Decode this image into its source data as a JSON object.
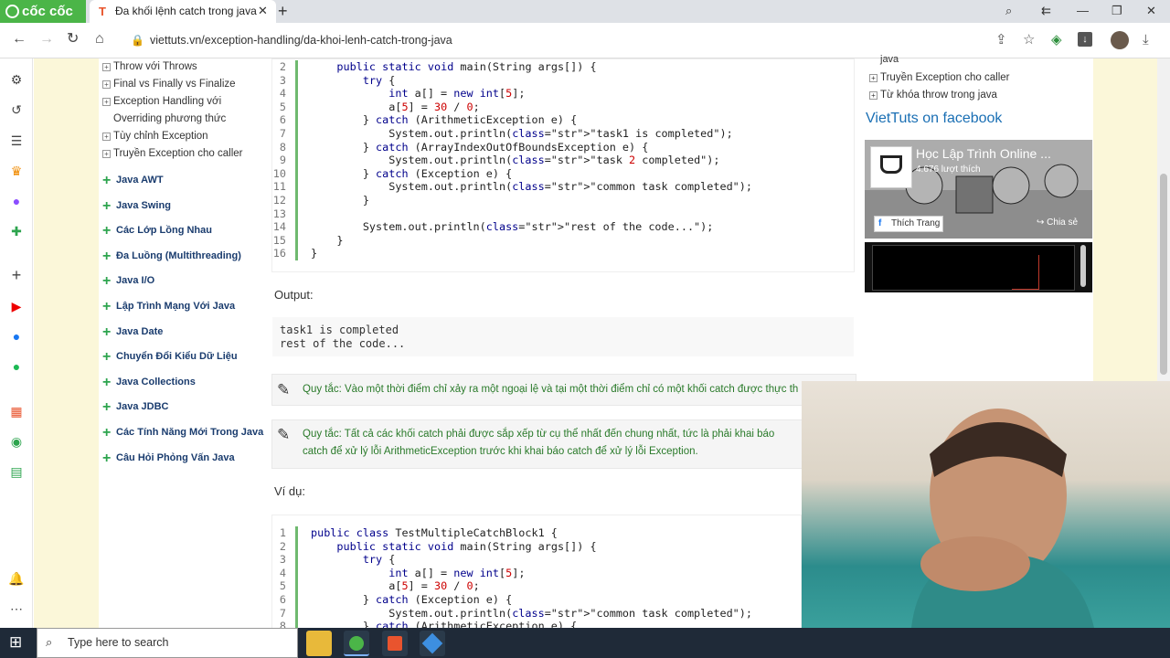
{
  "browser": {
    "brand": "cốc cốc",
    "tab_title": "Đa khối lệnh catch trong java",
    "tab_favicon": "T",
    "url": "viettuts.vn/exception-handling/da-khoi-lenh-catch-trong-java"
  },
  "menu": {
    "sub_items": [
      "Throw với Throws",
      "Final vs Finally vs Finalize",
      "Exception Handling với",
      "Overriding phương thức",
      "Tùy chỉnh Exception",
      "Truyền Exception cho caller"
    ],
    "main_items": [
      "Java AWT",
      "Java Swing",
      "Các Lớp Lồng Nhau",
      "Đa Luồng (Multithreading)",
      "Java I/O",
      "Lập Trình Mạng Với Java",
      "Java Date",
      "Chuyển Đổi Kiểu Dữ Liệu",
      "Java Collections",
      "Java JDBC",
      "Các Tính Năng Mới Trong Java",
      "Câu Hỏi Phỏng Vấn Java"
    ]
  },
  "code1": {
    "lines": [
      {
        "n": "2",
        "text": "    public static void main(String args[]) {"
      },
      {
        "n": "3",
        "text": "        try {"
      },
      {
        "n": "4",
        "text": "            int a[] = new int[5];"
      },
      {
        "n": "5",
        "text": "            a[5] = 30 / 0;"
      },
      {
        "n": "6",
        "text": "        } catch (ArithmeticException e) {"
      },
      {
        "n": "7",
        "text": "            System.out.println(\"task1 is completed\");"
      },
      {
        "n": "8",
        "text": "        } catch (ArrayIndexOutOfBoundsException e) {"
      },
      {
        "n": "9",
        "text": "            System.out.println(\"task 2 completed\");"
      },
      {
        "n": "10",
        "text": "        } catch (Exception e) {"
      },
      {
        "n": "11",
        "text": "            System.out.println(\"common task completed\");"
      },
      {
        "n": "12",
        "text": "        }"
      },
      {
        "n": "13",
        "text": ""
      },
      {
        "n": "14",
        "text": "        System.out.println(\"rest of the code...\");"
      },
      {
        "n": "15",
        "text": "    }"
      },
      {
        "n": "16",
        "text": "}"
      }
    ]
  },
  "output": {
    "label": "Output:",
    "lines": [
      "task1 is completed",
      "rest of the code..."
    ]
  },
  "rules": [
    {
      "text": "Quy tắc: Vào một thời điểm chỉ xảy ra một ngoại lệ và tại một thời điểm chỉ có một khối catch được thực th"
    },
    {
      "text1": "Quy tắc: Tất cả các khối catch phải được sắp xếp từ cụ thể nhất đến chung nhất, tức là phải khai báo",
      "text2": "catch để xử lý lỗi ArithmeticException trước khi khai báo catch để xử lý lỗi Exception."
    }
  ],
  "example_label": "Ví dụ:",
  "code2": {
    "lines": [
      {
        "n": "1",
        "text": "public class TestMultipleCatchBlock1 {"
      },
      {
        "n": "2",
        "text": "    public static void main(String args[]) {"
      },
      {
        "n": "3",
        "text": "        try {"
      },
      {
        "n": "4",
        "text": "            int a[] = new int[5];"
      },
      {
        "n": "5",
        "text": "            a[5] = 30 / 0;"
      },
      {
        "n": "6",
        "text": "        } catch (Exception e) {"
      },
      {
        "n": "7",
        "text": "            System.out.println(\"common task completed\");"
      },
      {
        "n": "8",
        "text": "        } catch (ArithmeticException e) {"
      }
    ]
  },
  "right": {
    "links": [
      "java",
      "Truyền Exception cho caller",
      "Từ khóa throw trong java"
    ],
    "fb_title": "VietTuts on facebook",
    "fb_page_name": "Học Lập Trình Online ...",
    "fb_likes": "4.676 lượt thích",
    "fb_like": "Thích Trang",
    "fb_share": "Chia sẻ"
  },
  "taskbar": {
    "search_placeholder": "Type here to search"
  }
}
